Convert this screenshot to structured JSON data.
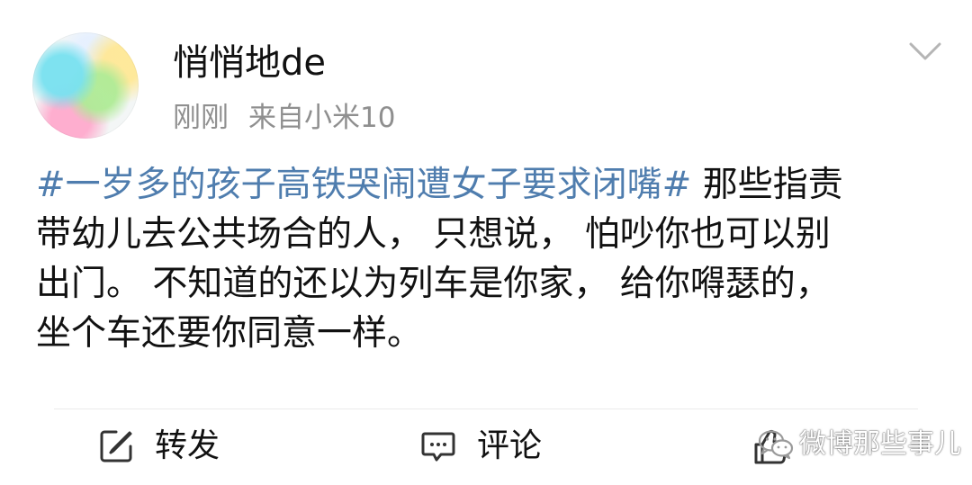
{
  "header": {
    "username": "悄悄地de",
    "time": "刚刚",
    "source": "来自小米10"
  },
  "content": {
    "hashtag": "#一岁多的孩子高铁哭闹遭女子要求闭嘴#",
    "line1_rest": " 那些指责",
    "line2": "带幼儿去公共场合的人， 只想说， 怕吵你也可以别",
    "line3": "出门。 不知道的还以为列车是你家， 给你嘚瑟的，",
    "line4": "坐个车还要你同意一样。"
  },
  "actions": {
    "repost_label": "转发",
    "comment_label": "评论"
  },
  "watermark": {
    "text": "微博那些事儿"
  },
  "colors": {
    "hashtag": "#4f7dae",
    "meta": "#8f8f8f",
    "text": "#111111",
    "divider": "#ebebeb"
  },
  "icons": {
    "menu": "chevron-down-icon",
    "repost": "repost-icon",
    "comment": "comment-icon",
    "like": "thumbs-up-icon",
    "watermark": "wechat-icon"
  }
}
